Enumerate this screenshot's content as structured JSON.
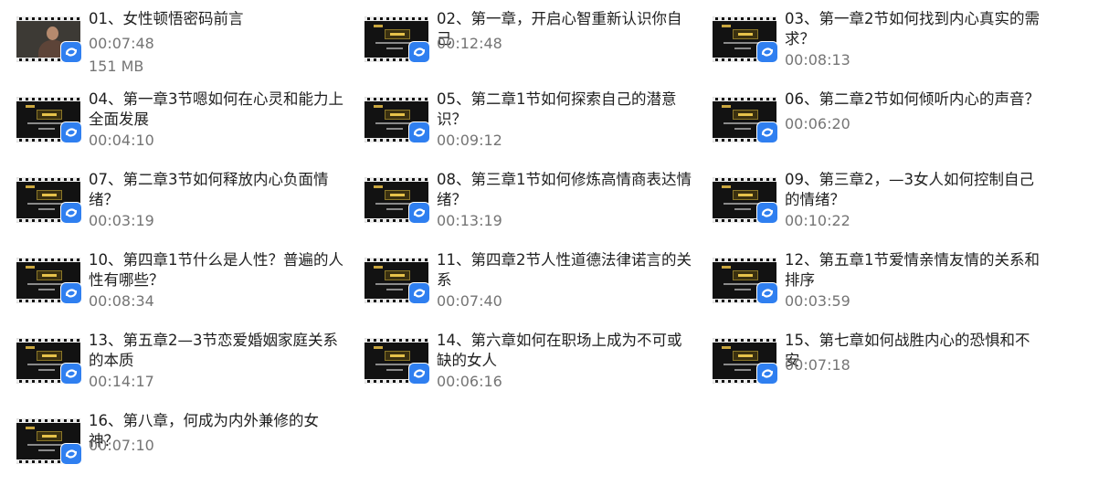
{
  "videos": [
    {
      "title": "01、女性顿悟密码前言",
      "duration": "00:07:48",
      "size": "151 MB",
      "thumb": "person"
    },
    {
      "title": "02、第一章，开启心智重新认识你自己",
      "duration": "00:12:48",
      "thumb": "chapter"
    },
    {
      "title": "03、第一章2节如何找到内心真实的需求？",
      "duration": "00:08:13",
      "thumb": "chapter"
    },
    {
      "title": "04、第一章3节嗯如何在心灵和能力上全面发展",
      "duration": "00:04:10",
      "thumb": "chapter"
    },
    {
      "title": "05、第二章1节如何探索自己的潜意识？",
      "duration": "00:09:12",
      "thumb": "chapter"
    },
    {
      "title": "06、第二章2节如何倾听内心的声音？",
      "duration": "00:06:20",
      "thumb": "chapter"
    },
    {
      "title": "07、第二章3节如何释放内心负面情绪？",
      "duration": "00:03:19",
      "thumb": "chapter"
    },
    {
      "title": "08、第三章1节如何修炼高情商表达情绪？",
      "duration": "00:13:19",
      "thumb": "chapter"
    },
    {
      "title": "09、第三章2，—3女人如何控制自己的情绪？",
      "duration": "00:10:22",
      "thumb": "chapter"
    },
    {
      "title": "10、第四章1节什么是人性？普遍的人性有哪些？",
      "duration": "00:08:34",
      "thumb": "chapter"
    },
    {
      "title": "11、第四章2节人性道德法律诺言的关系",
      "duration": "00:07:40",
      "thumb": "chapter"
    },
    {
      "title": "12、第五章1节爱情亲情友情的关系和排序",
      "duration": "00:03:59",
      "thumb": "chapter"
    },
    {
      "title": "13、第五章2—3节恋爱婚姻家庭关系的本质",
      "duration": "00:14:17",
      "thumb": "chapter"
    },
    {
      "title": "14、第六章如何在职场上成为不可或缺的女人",
      "duration": "00:06:16",
      "thumb": "chapter"
    },
    {
      "title": "15、第七章如何战胜内心的恐惧和不安",
      "duration": "00:07:18",
      "thumb": "chapter"
    },
    {
      "title": "16、第八章，何成为内外兼修的女神？",
      "duration": "00:07:10",
      "thumb": "chapter"
    }
  ],
  "icons": {
    "video_badge": "cloud-sync-icon"
  },
  "colors": {
    "badge": "#2f7ff0",
    "title": "#1f1f1f",
    "meta": "#757575"
  }
}
